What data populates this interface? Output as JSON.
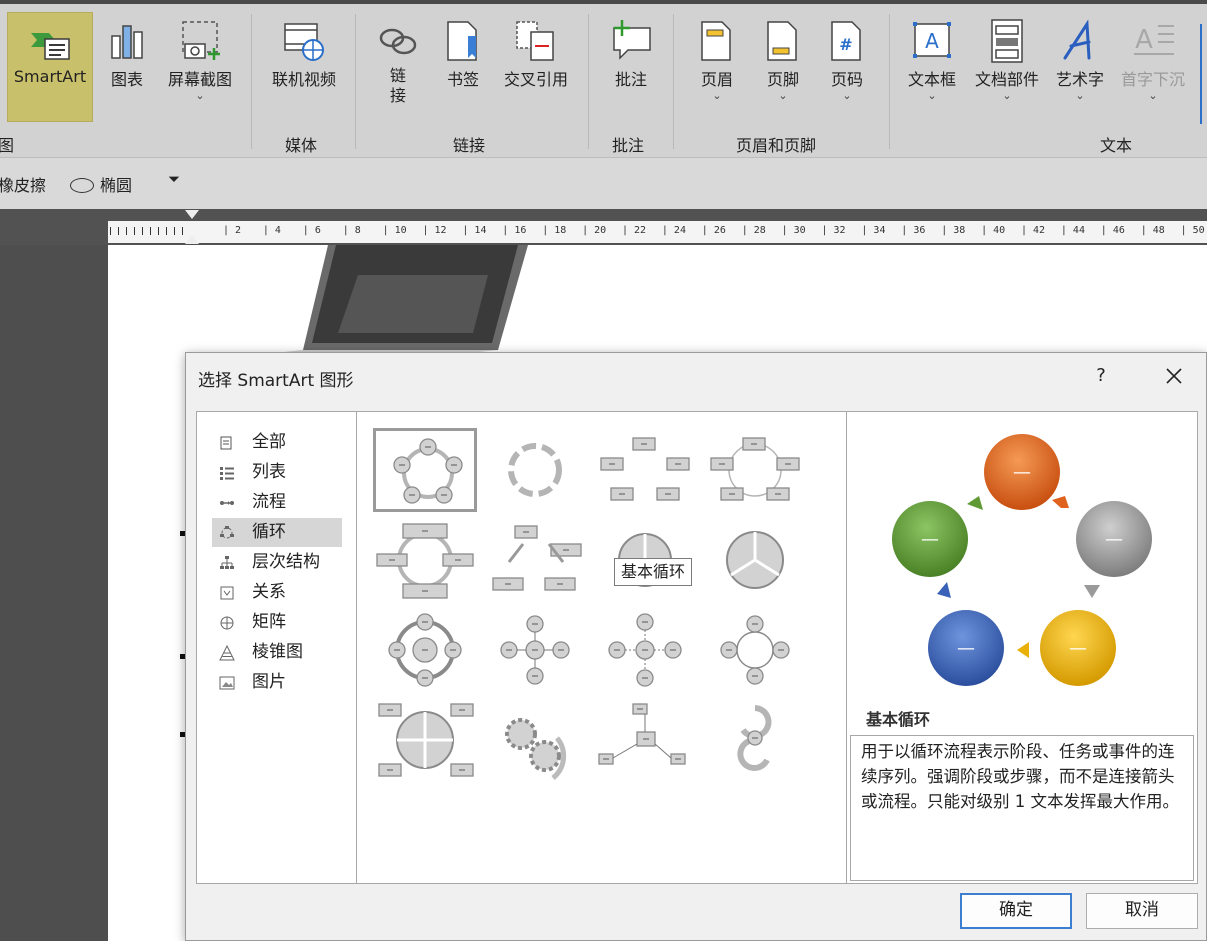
{
  "ribbon": {
    "buttons": {
      "smartart": "SmartArt",
      "chart": "图表",
      "screenshot": "屏幕截图",
      "online_video": "联机视频",
      "link": "链\n接",
      "bookmark": "书签",
      "cross_ref": "交叉引用",
      "comment": "批注",
      "header": "页眉",
      "footer": "页脚",
      "page_number": "页码",
      "text_box": "文本框",
      "quick_parts": "文档部件",
      "wordart": "艺术字",
      "drop_cap": "首字下沉"
    },
    "groups": {
      "illustrations_partial": "图",
      "media": "媒体",
      "links": "链接",
      "comments": "批注",
      "header_footer": "页眉和页脚",
      "text": "文本"
    }
  },
  "subbar": {
    "eraser": "橡皮擦",
    "ellipse": "椭圆"
  },
  "ruler": {
    "labels": [
      "2",
      "4",
      "6",
      "8",
      "10",
      "12",
      "14",
      "16",
      "18",
      "20",
      "22",
      "24",
      "26",
      "28",
      "30",
      "32",
      "34",
      "36",
      "38",
      "40",
      "42",
      "44",
      "46",
      "48",
      "50"
    ]
  },
  "dialog": {
    "title": "选择 SmartArt 图形",
    "help": "?",
    "categories": [
      {
        "label": "全部",
        "icon": "all-icon"
      },
      {
        "label": "列表",
        "icon": "list-icon"
      },
      {
        "label": "流程",
        "icon": "process-icon"
      },
      {
        "label": "循环",
        "icon": "cycle-icon"
      },
      {
        "label": "层次结构",
        "icon": "hierarchy-icon"
      },
      {
        "label": "关系",
        "icon": "relationship-icon"
      },
      {
        "label": "矩阵",
        "icon": "matrix-icon"
      },
      {
        "label": "棱锥图",
        "icon": "pyramid-icon"
      },
      {
        "label": "图片",
        "icon": "picture-icon"
      }
    ],
    "selected_category": "循环",
    "tooltip": "基本循环",
    "preview": {
      "title": "基本循环",
      "description": "用于以循环流程表示阶段、任务或事件的连续序列。强调阶段或步骤，而不是连接箭头或流程。只能对级别 1 文本发挥最大作用。",
      "node_label": "—",
      "colors": {
        "orange": "#e0621f",
        "gray": "#9a9a9a",
        "yellow": "#e8b008",
        "blue": "#3a62b8",
        "green": "#5f9a35"
      }
    },
    "ok": "确定",
    "cancel": "取消"
  }
}
